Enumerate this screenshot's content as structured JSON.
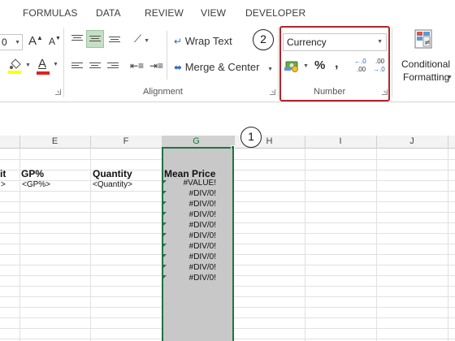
{
  "ribbon_tabs": [
    "FORMULAS",
    "DATA",
    "REVIEW",
    "VIEW",
    "DEVELOPER"
  ],
  "font_group": {
    "size_value": "0",
    "grow_font": "A",
    "shrink_font": "A",
    "font_color_letter": "A"
  },
  "alignment": {
    "wrap_text": "Wrap Text",
    "merge_center": "Merge & Center",
    "group_label": "Alignment"
  },
  "number": {
    "format_value": "Currency",
    "percent": "%",
    "comma": ",",
    "increase_decimal_top": "←.0",
    "increase_decimal_bottom": ".00",
    "decrease_decimal_top": ".00",
    "decrease_decimal_bottom": "→.0",
    "group_label": "Number"
  },
  "styles": {
    "conditional_line1": "Conditional",
    "conditional_line2": "Formatting"
  },
  "callouts": {
    "one": "1",
    "two": "2"
  },
  "columns": [
    "E",
    "F",
    "G",
    "H",
    "I",
    "J"
  ],
  "sheet": {
    "headers": {
      "d_partial": "it",
      "e": "GP%",
      "f": "Quantity",
      "g": "Mean Price"
    },
    "placeholders": {
      "d_partial": ">",
      "e": "<GP%>",
      "f": "<Quantity>"
    },
    "g_values": [
      "#VALUE!",
      "#DIV/0!",
      "#DIV/0!",
      "#DIV/0!",
      "#DIV/0!",
      "#DIV/0!",
      "#DIV/0!",
      "#DIV/0!",
      "#DIV/0!",
      "#DIV/0!"
    ]
  },
  "colors": {
    "selection_border": "#217346",
    "highlight_box": "#b1262b",
    "selected_fill": "#c8c8c8"
  }
}
